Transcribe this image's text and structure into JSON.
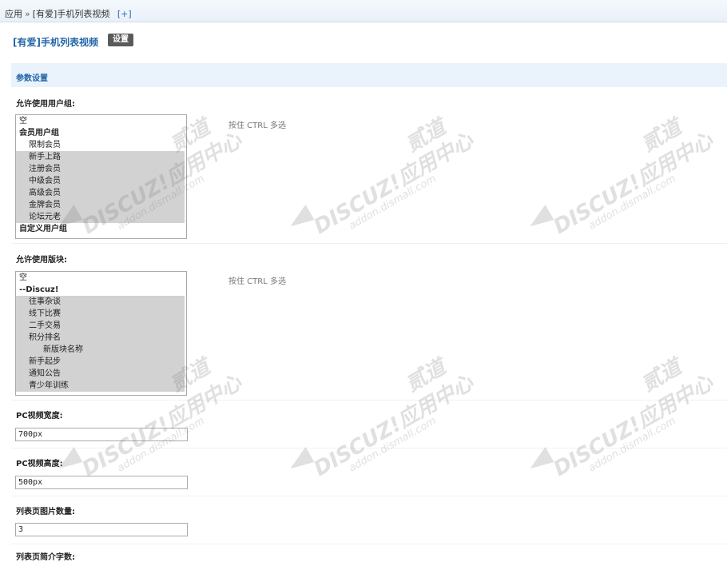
{
  "breadcrumb": {
    "root": "应用",
    "separator": "»",
    "current": "[有爱]手机列表视频",
    "add": "[+]"
  },
  "plugin": {
    "title": "[有爱]手机列表视频",
    "setting_label": "设置"
  },
  "section": {
    "title": "参数设置"
  },
  "fields": {
    "usergroups": {
      "label": "允许使用用户组:",
      "hint": "按住 CTRL 多选",
      "options": [
        {
          "text": "空",
          "selected": false,
          "level": 0,
          "group": false
        },
        {
          "text": "会员用户组",
          "selected": false,
          "level": 0,
          "group": true
        },
        {
          "text": "限制会员",
          "selected": false,
          "level": 1,
          "group": false
        },
        {
          "text": "新手上路",
          "selected": true,
          "level": 1,
          "group": false
        },
        {
          "text": "注册会员",
          "selected": true,
          "level": 1,
          "group": false
        },
        {
          "text": "中级会员",
          "selected": true,
          "level": 1,
          "group": false
        },
        {
          "text": "高级会员",
          "selected": true,
          "level": 1,
          "group": false
        },
        {
          "text": "金牌会员",
          "selected": true,
          "level": 1,
          "group": false
        },
        {
          "text": "论坛元老",
          "selected": true,
          "level": 1,
          "group": false
        },
        {
          "text": "自定义用户组",
          "selected": false,
          "level": 0,
          "group": true
        }
      ]
    },
    "forums": {
      "label": "允许使用版块:",
      "hint": "按住 CTRL 多选",
      "options": [
        {
          "text": "空",
          "selected": false,
          "level": 0,
          "group": false
        },
        {
          "text": "--Discuz!",
          "selected": false,
          "level": 0,
          "group": true
        },
        {
          "text": "往事杂谈",
          "selected": true,
          "level": 1,
          "group": false
        },
        {
          "text": "线下比赛",
          "selected": true,
          "level": 1,
          "group": false
        },
        {
          "text": "二手交易",
          "selected": true,
          "level": 1,
          "group": false
        },
        {
          "text": "积分排名",
          "selected": true,
          "level": 1,
          "group": false
        },
        {
          "text": "新版块名称",
          "selected": true,
          "level": 2,
          "group": false
        },
        {
          "text": "新手起步",
          "selected": true,
          "level": 1,
          "group": false
        },
        {
          "text": "通知公告",
          "selected": true,
          "level": 1,
          "group": false
        },
        {
          "text": "青少年训练",
          "selected": true,
          "level": 1,
          "group": false
        }
      ]
    },
    "pc_width": {
      "label": "PC视频宽度:",
      "value": "700px"
    },
    "pc_height": {
      "label": "PC视频高度:",
      "value": "500px"
    },
    "list_image_count": {
      "label": "列表页图片数量:",
      "value": "3"
    },
    "list_intro_chars": {
      "label": "列表页简介字数:"
    }
  },
  "watermark": {
    "brand": "DISCUZ!应用中心",
    "domain": "addon.dismall.com",
    "extra": "贰道"
  }
}
